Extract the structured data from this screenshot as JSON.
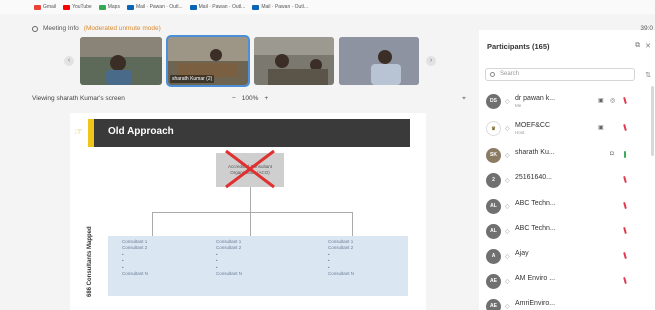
{
  "bookmarks": [
    {
      "label": "Gmail",
      "color": "#ea4335"
    },
    {
      "label": "YouTube",
      "color": "#ff0000"
    },
    {
      "label": "Maps",
      "color": "#34a853"
    },
    {
      "label": "Mail · Pawan · Outl...",
      "color": "#0a64b4"
    },
    {
      "label": "Mail · Pawan · Outl...",
      "color": "#0a64b4"
    },
    {
      "label": "Mail · Pawan · Outl...",
      "color": "#0a64b4"
    }
  ],
  "meeting": {
    "info_label": "Meeting Info",
    "moderated_label": "(Moderated unmute mode)",
    "clock": "39:0"
  },
  "video_tiles": [
    {
      "name": ""
    },
    {
      "name": "sharath Kumar (2)"
    },
    {
      "name": ""
    },
    {
      "name": ""
    }
  ],
  "share": {
    "viewing_text": "Viewing sharath Kumar's screen",
    "zoom_minus": "−",
    "zoom_level": "100%",
    "zoom_plus": "+"
  },
  "slide": {
    "title": "Old Approach",
    "box_line1": "Accredited Consultant",
    "box_line2": "Organization (ACO)",
    "col1": [
      "Consultant 1",
      "Consultant 2",
      "•",
      "•",
      "•",
      "Consultant N"
    ],
    "col2": [
      "Consultant 1",
      "Consultant 2",
      "•",
      "•",
      "•",
      "Consultant N"
    ],
    "col3": [
      "Consultant 1",
      "Consultant 2",
      "•",
      "•",
      "•",
      "Consultant N"
    ],
    "side_label": "686 Consultants Mapped"
  },
  "participants": {
    "title": "Participants (165)",
    "search_placeholder": "Search",
    "list": [
      {
        "initials": "DS",
        "name": "dr pawan k...",
        "sub": "Me",
        "mic": "off",
        "style": "initials"
      },
      {
        "initials": "",
        "name": "MOEF&CC",
        "sub": "Host",
        "mic": "off",
        "style": "logo"
      },
      {
        "initials": "SK",
        "name": "sharath Ku...",
        "sub": "",
        "mic": "on",
        "style": "photo"
      },
      {
        "initials": "2",
        "name": "25161640...",
        "sub": "",
        "mic": "off",
        "style": "initials"
      },
      {
        "initials": "AL",
        "name": "ABC Techn...",
        "sub": "",
        "mic": "off",
        "style": "initials"
      },
      {
        "initials": "AL",
        "name": "ABC Techn...",
        "sub": "",
        "mic": "off",
        "style": "initials"
      },
      {
        "initials": "A",
        "name": "Ajay",
        "sub": "",
        "mic": "off",
        "style": "initials"
      },
      {
        "initials": "AE",
        "name": "AM Enviro ...",
        "sub": "",
        "mic": "off",
        "style": "initials"
      },
      {
        "initials": "AE",
        "name": "AmriEnviro...",
        "sub": "",
        "mic": "off",
        "style": "initials"
      }
    ]
  }
}
